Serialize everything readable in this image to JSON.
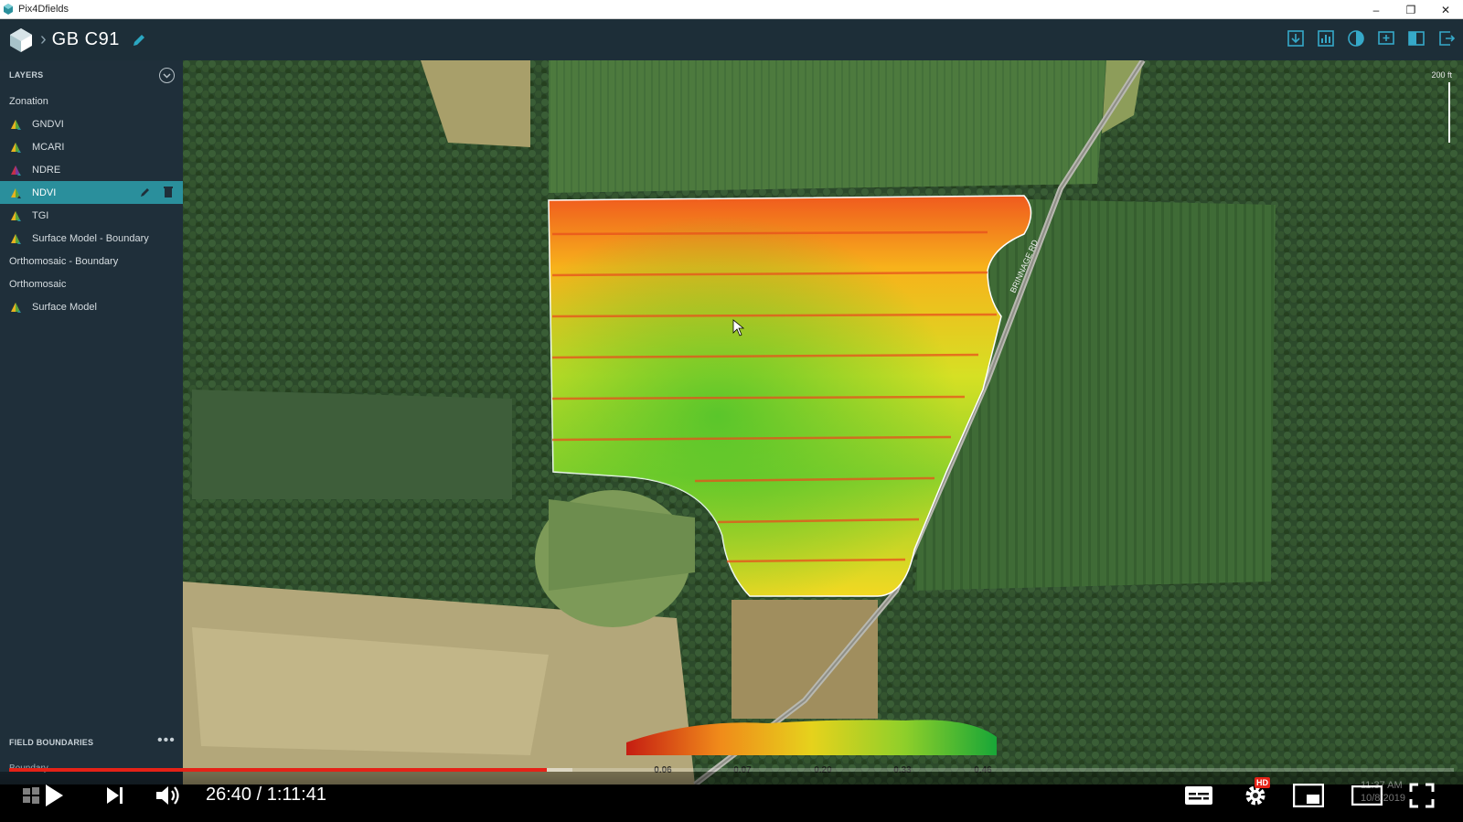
{
  "window": {
    "title": "Pix4Dfields",
    "controls": {
      "minimize": "–",
      "restore": "❐",
      "close": "✕"
    }
  },
  "app": {
    "breadcrumb_separator": "›",
    "project_name": "GB C91",
    "toolbar_icons": [
      "export-icon",
      "stats-icon",
      "index-icon",
      "zonation-icon",
      "compare-icon",
      "share-icon"
    ]
  },
  "sidebar": {
    "layers_heading": "LAYERS",
    "layers": [
      {
        "label": "Zonation",
        "icon": "none"
      },
      {
        "label": "GNDVI",
        "icon": "layer-icon"
      },
      {
        "label": "MCARI",
        "icon": "layer-icon"
      },
      {
        "label": "NDRE",
        "icon": "layer-icon"
      },
      {
        "label": "NDVI",
        "icon": "layer-icon",
        "selected": true
      },
      {
        "label": "TGI",
        "icon": "layer-icon"
      },
      {
        "label": "Surface Model - Boundary",
        "icon": "layer-icon"
      },
      {
        "label": "Orthomosaic - Boundary",
        "icon": "none"
      },
      {
        "label": "Orthomosaic",
        "icon": "none"
      },
      {
        "label": "Surface Model",
        "icon": "layer-icon"
      }
    ],
    "field_boundaries_heading": "FIELD BOUNDARIES",
    "field_boundaries_more": "•••",
    "field_boundary_item": "Boundary"
  },
  "map": {
    "scale_label": "200 ft",
    "road_label": "BRINNAGE RD",
    "legend_ticks": [
      "0.06",
      "0.07",
      "0.20",
      "0.33",
      "0.46"
    ]
  },
  "video": {
    "time": "26:40 / 1:11:41",
    "progress": 0.372,
    "hd_badge": "HD",
    "clock_time": "11:37 AM",
    "clock_date": "10/8/2019"
  },
  "colors": {
    "sidebar_bg": "#1f2f3a",
    "appbar_bg": "#1d2e38",
    "selected_layer": "#2a8f9c",
    "progress_red": "#e52217"
  }
}
